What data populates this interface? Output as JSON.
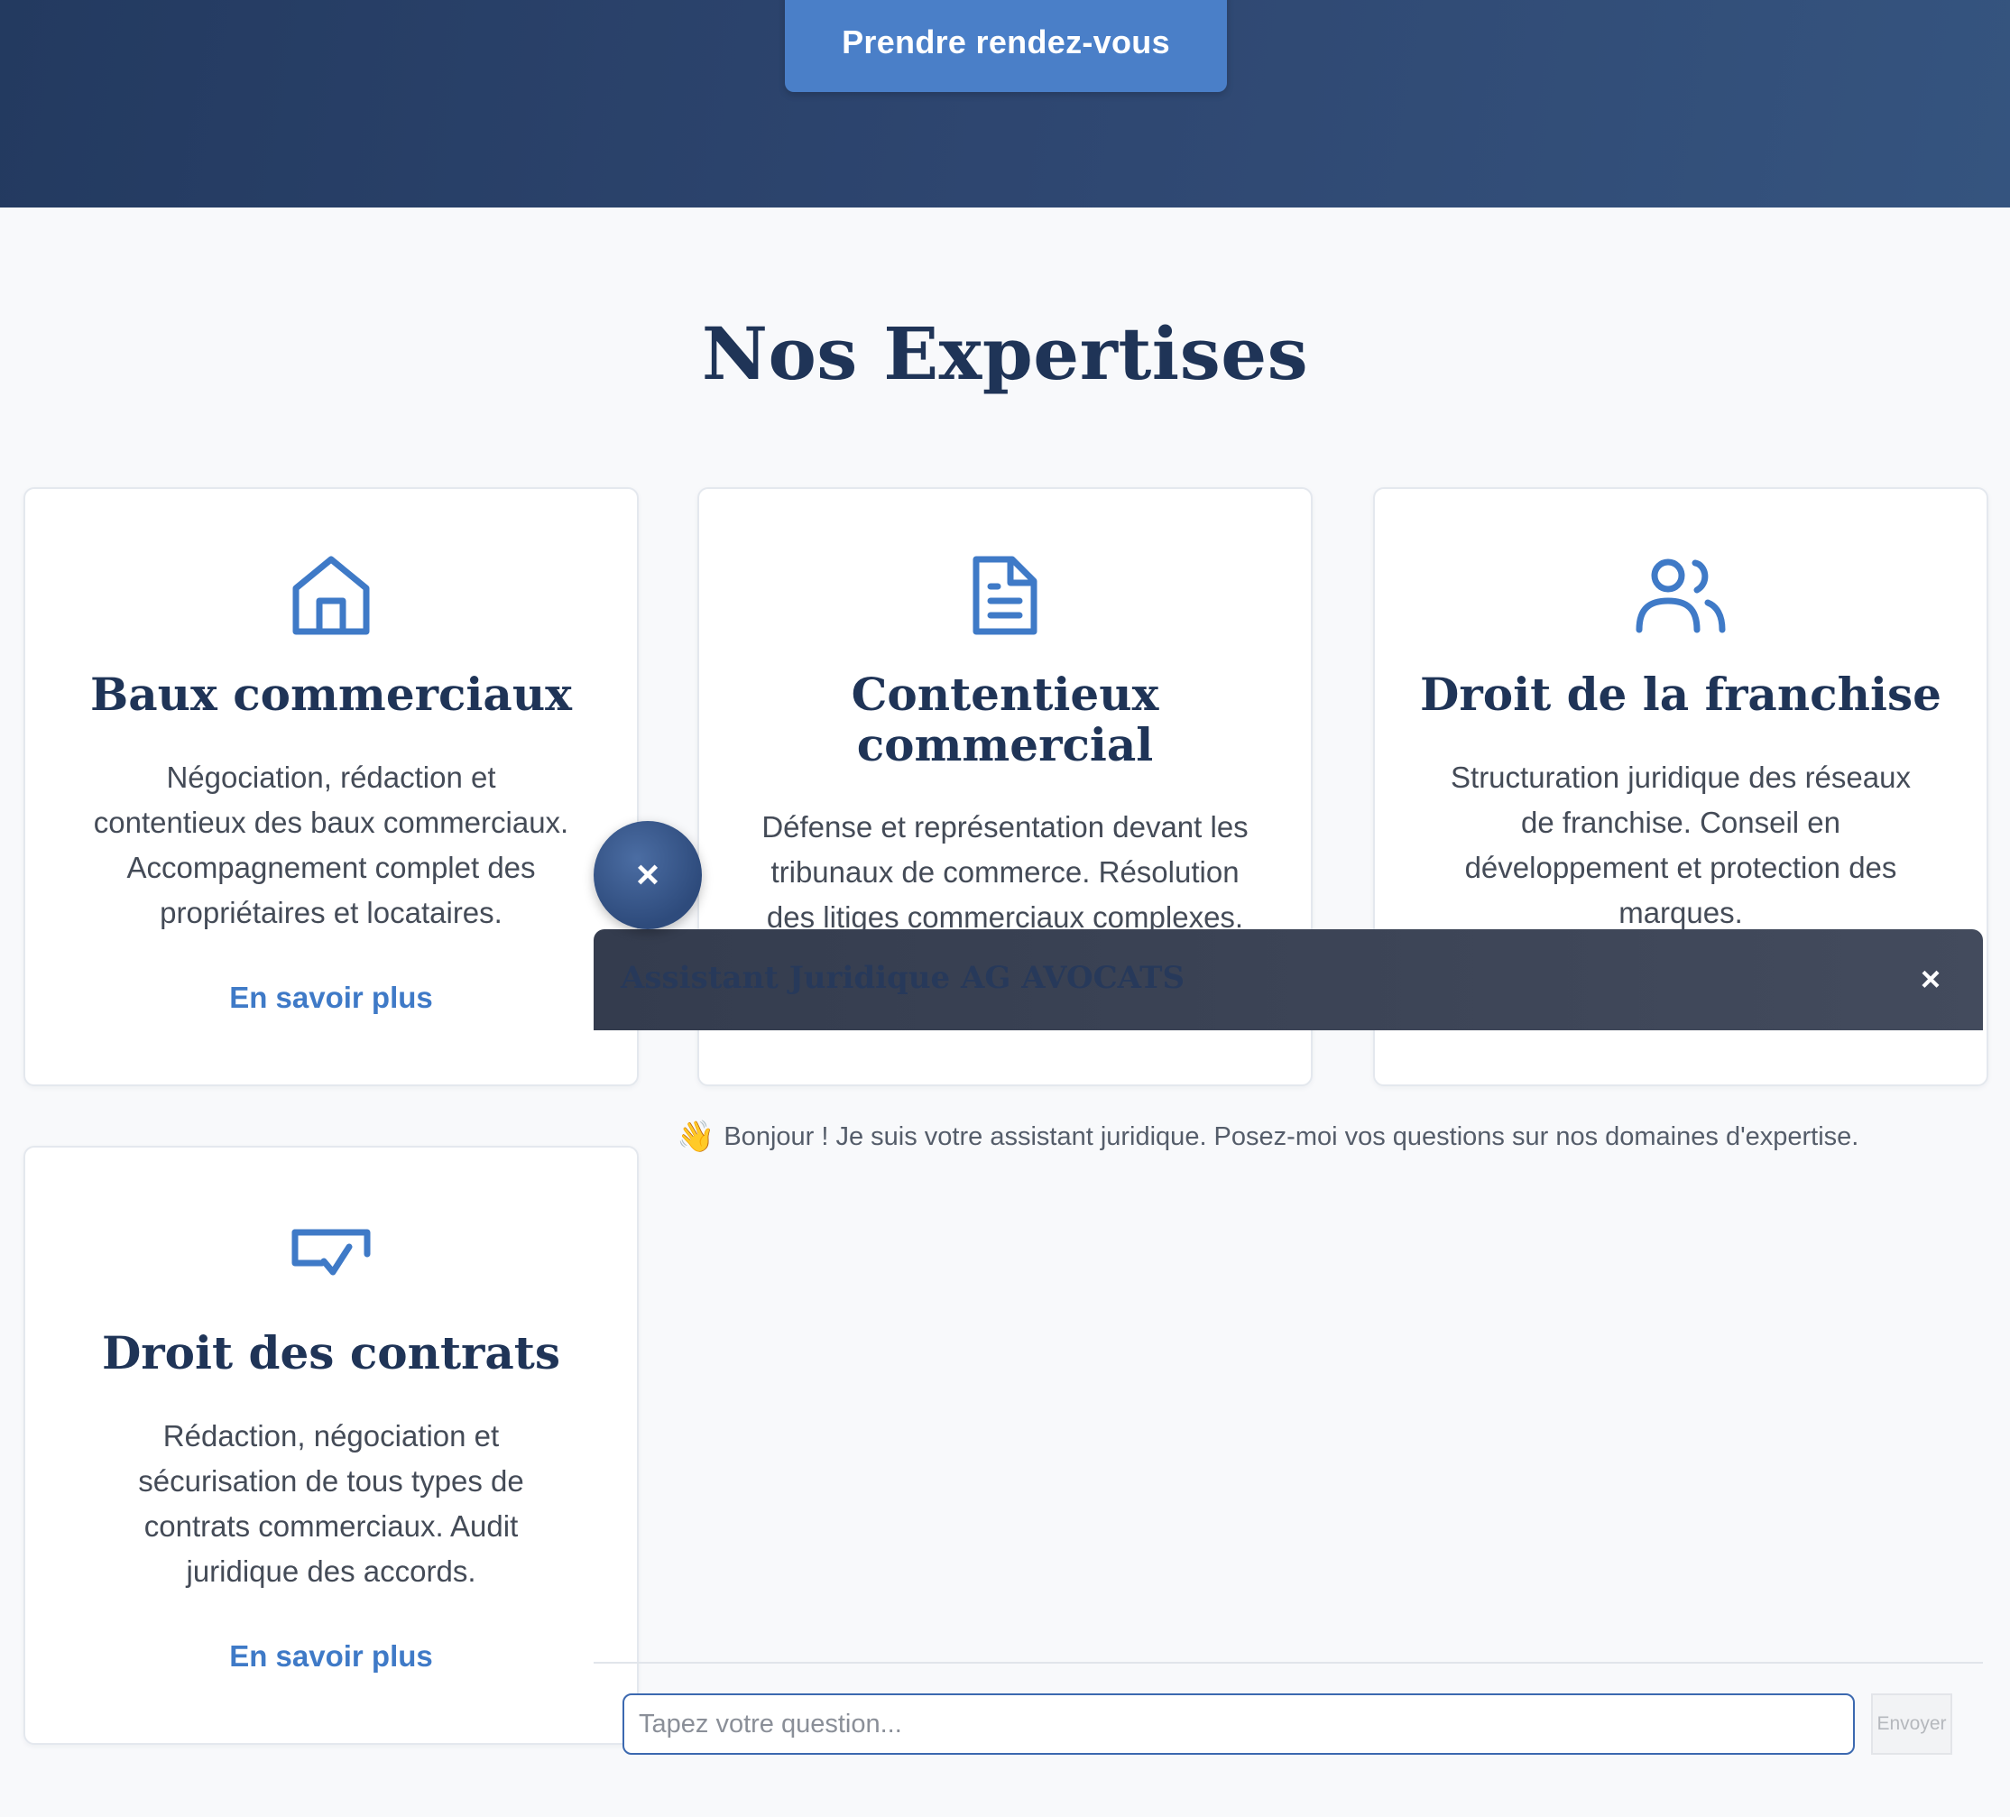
{
  "hero": {
    "cta_label": "Prendre rendez-vous"
  },
  "expertises": {
    "title": "Nos Expertises",
    "cards": [
      {
        "icon": "home-icon",
        "title": "Baux commerciaux",
        "desc_lines": [
          "Négociation, rédaction et",
          "contentieux des baux commerciaux.",
          "Accompagnement complet des",
          "propriétaires et locataires."
        ],
        "link": "En savoir plus"
      },
      {
        "icon": "document-icon",
        "title_lines": [
          "Contentieux",
          "commercial"
        ],
        "desc_lines": [
          "Défense et représentation devant les",
          "tribunaux de commerce. Résolution",
          "des litiges commerciaux complexes."
        ]
      },
      {
        "icon": "users-icon",
        "title": "Droit de la franchise",
        "desc_lines": [
          "Structuration juridique des réseaux",
          "de franchise. Conseil en",
          "développement et protection des",
          "marques."
        ]
      },
      {
        "icon": "contract-check-icon",
        "title": "Droit des contrats",
        "desc_lines": [
          "Rédaction, négociation et",
          "sécurisation de tous types de",
          "contrats commerciaux. Audit",
          "juridique des accords."
        ],
        "link": "En savoir plus"
      }
    ]
  },
  "chat": {
    "toggle_icon": "×",
    "title": "Assistant Juridique AG AVOCATS",
    "close_icon": "×",
    "greeting_emoji": "👋",
    "greeting": "Bonjour ! Je suis votre assistant juridique. Posez-moi vos questions sur nos domaines d'expertise.",
    "input_placeholder": "Tapez votre question...",
    "send_label": "Envoyer"
  },
  "colors": {
    "hero": "#2e4670",
    "accent": "#4a7fc8",
    "heading": "#1f3457"
  }
}
